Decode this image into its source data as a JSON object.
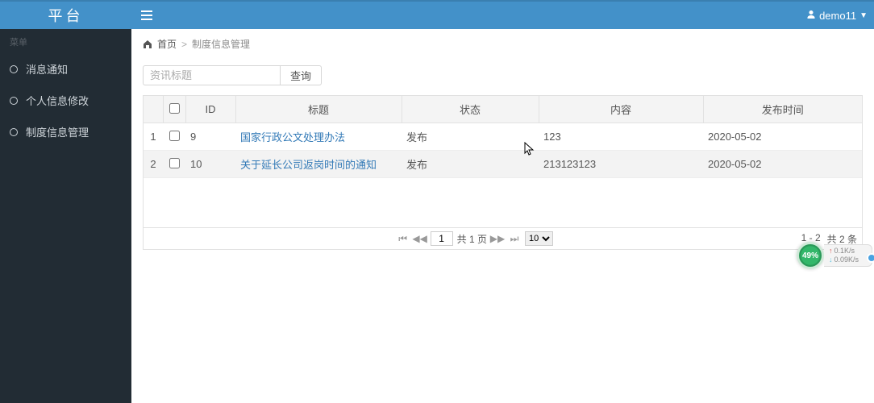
{
  "brand": "平台",
  "user": {
    "name": "demo11"
  },
  "sidebar": {
    "menu_title": "菜单",
    "items": [
      {
        "label": "消息通知"
      },
      {
        "label": "个人信息修改"
      },
      {
        "label": "制度信息管理"
      }
    ]
  },
  "breadcrumb": {
    "home": "首页",
    "current": "制度信息管理"
  },
  "search": {
    "placeholder": "资讯标题",
    "button": "查询"
  },
  "table": {
    "headers": {
      "id": "ID",
      "title": "标题",
      "status": "状态",
      "content": "内容",
      "publish_time": "发布时间"
    },
    "rows": [
      {
        "rownum": "1",
        "id": "9",
        "title": "国家行政公文处理办法",
        "status": "发布",
        "content": "123",
        "publish_time": "2020-05-02"
      },
      {
        "rownum": "2",
        "id": "10",
        "title": "关于延长公司返岗时间的通知",
        "status": "发布",
        "content": "213123123",
        "publish_time": "2020-05-02"
      }
    ]
  },
  "pager": {
    "current_page": "1",
    "total_pages_text": "共 1 页",
    "page_size": "10",
    "range": "1 - 2",
    "total_text": "共 2 条"
  },
  "net": {
    "percent": "49%",
    "up": "0.1K/s",
    "down": "0.09K/s"
  }
}
